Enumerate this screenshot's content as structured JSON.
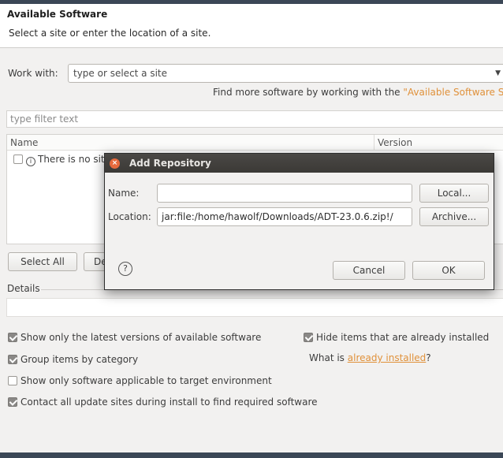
{
  "page": {
    "title": "Available Software",
    "subtitle": "Select a site or enter the location of a site."
  },
  "work_with": {
    "label": "Work with:",
    "placeholder": "type or select a site"
  },
  "find_more": {
    "prefix": "Find more software by working with the ",
    "link": "\"Available Software S"
  },
  "filter": {
    "placeholder": "type filter text"
  },
  "table": {
    "columns": [
      "Name",
      "Version"
    ],
    "rows": [
      {
        "text": "There is no sit",
        "checked": false,
        "icon": "info-icon"
      }
    ]
  },
  "buttons": {
    "select_all": "Select All",
    "deselect_all": "De"
  },
  "details": {
    "label": "Details"
  },
  "options": {
    "latest_versions": {
      "label": "Show only the latest versions of available software",
      "checked": true
    },
    "group_by_category": {
      "label": "Group items by category",
      "checked": true
    },
    "applicable_only": {
      "label": "Show only software applicable to target environment",
      "checked": false
    },
    "contact_all": {
      "label": "Contact all update sites during install to find required software",
      "checked": true
    },
    "hide_installed": {
      "label": "Hide items that are already installed",
      "checked": true
    },
    "what_is": {
      "prefix": "What is ",
      "link": "already installed",
      "suffix": "?"
    }
  },
  "dialog": {
    "title": "Add Repository",
    "name_label": "Name:",
    "name_value": "",
    "location_label": "Location:",
    "location_value": "jar:file:/home/hawolf/Downloads/ADT-23.0.6.zip!/",
    "local_button": "Local...",
    "archive_button": "Archive...",
    "cancel_button": "Cancel",
    "ok_button": "OK",
    "help_glyph": "?",
    "close_glyph": "×"
  },
  "colors": {
    "link": "#e0913a",
    "title_bar": "#3b3936",
    "close_button": "#e66a3d"
  }
}
